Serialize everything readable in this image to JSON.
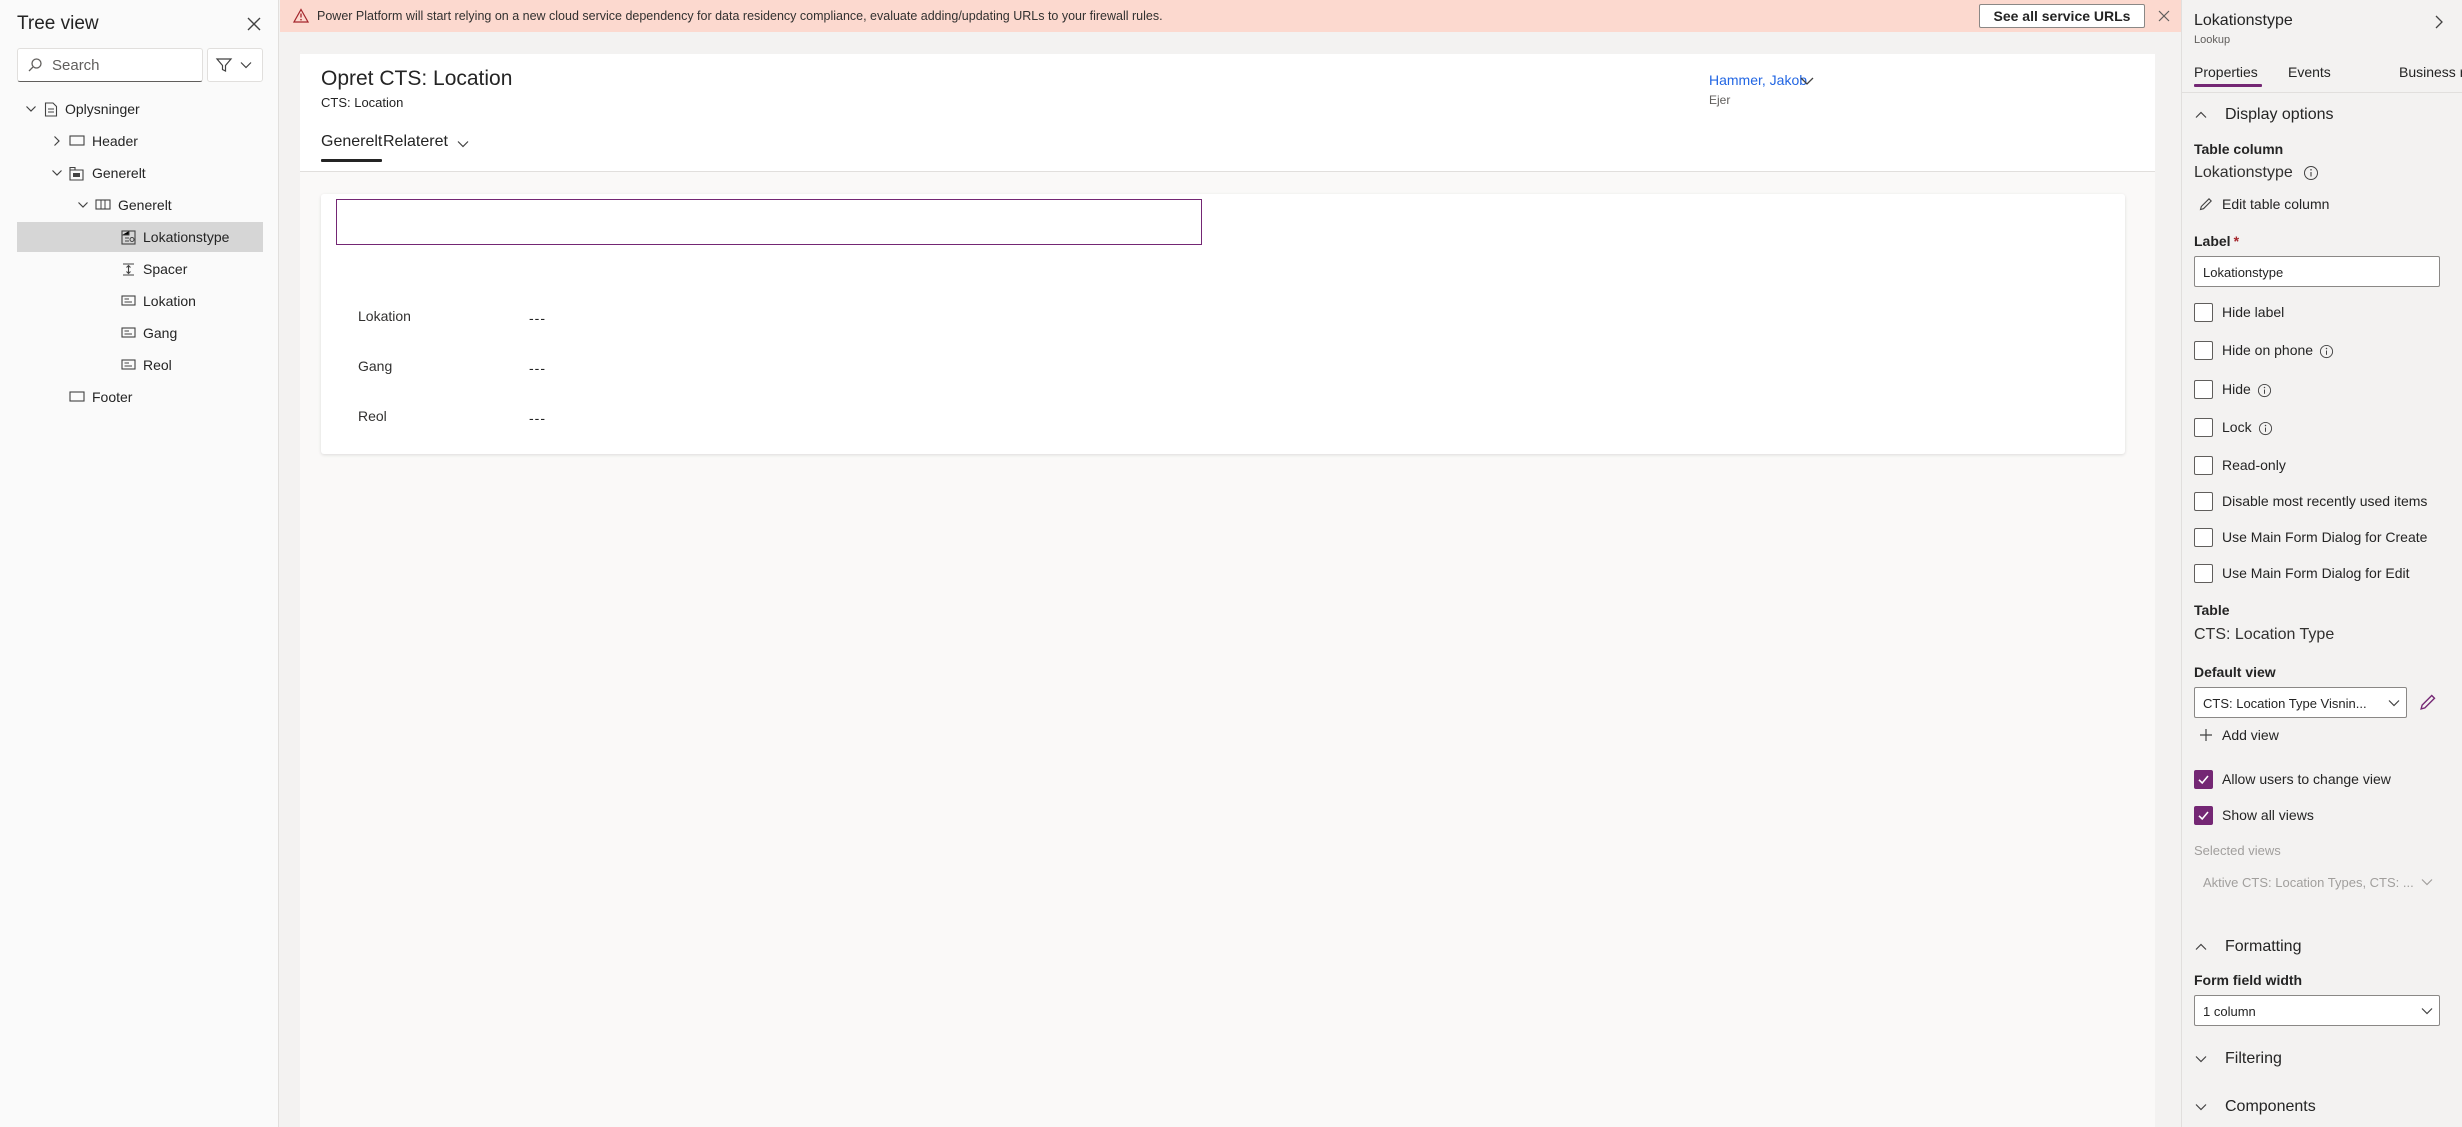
{
  "tree": {
    "title": "Tree view",
    "search_placeholder": "Search",
    "items": [
      {
        "label": "Oplysninger",
        "type": "form"
      },
      {
        "label": "Header",
        "type": "header"
      },
      {
        "label": "Generelt",
        "type": "tab"
      },
      {
        "label": "Generelt",
        "type": "section"
      },
      {
        "label": "Lokationstype",
        "type": "lookup-field",
        "selected": true
      },
      {
        "label": "Spacer",
        "type": "spacer"
      },
      {
        "label": "Lokation",
        "type": "field"
      },
      {
        "label": "Gang",
        "type": "field"
      },
      {
        "label": "Reol",
        "type": "field"
      },
      {
        "label": "Footer",
        "type": "footer"
      }
    ]
  },
  "banner": {
    "message": "Power Platform will start relying on a new cloud service dependency for data residency compliance, evaluate adding/updating URLs to your firewall rules.",
    "button_label": "See all service URLs"
  },
  "form": {
    "title": "Opret CTS: Location",
    "subtitle": "CTS: Location",
    "owner_name": "Hammer, Jakob",
    "owner_label": "Ejer",
    "tabs": [
      {
        "label": "Generelt",
        "active": true
      },
      {
        "label": "Relateret",
        "active": false
      }
    ],
    "fields": [
      {
        "label": "Lokation",
        "value": "---"
      },
      {
        "label": "Gang",
        "value": "---"
      },
      {
        "label": "Reol",
        "value": "---"
      }
    ]
  },
  "properties": {
    "title": "Lokationstype",
    "subtitle": "Lookup",
    "tabs": [
      "Properties",
      "Events",
      "Business rules"
    ],
    "display_options": {
      "heading": "Display options",
      "table_column_label": "Table column",
      "table_column_value": "Lokationstype",
      "edit_table_column": "Edit table column",
      "label_caption": "Label",
      "label_required": "*",
      "label_value": "Lokationstype",
      "checkboxes": [
        {
          "label": "Hide label",
          "checked": false
        },
        {
          "label": "Hide on phone",
          "checked": false
        },
        {
          "label": "Hide",
          "checked": false
        },
        {
          "label": "Lock",
          "checked": false
        },
        {
          "label": "Read-only",
          "checked": false
        },
        {
          "label": "Disable most recently used items",
          "checked": false
        },
        {
          "label": "Use Main Form Dialog for Create",
          "checked": false
        },
        {
          "label": "Use Main Form Dialog for Edit",
          "checked": false
        }
      ],
      "table_label": "Table",
      "table_value": "CTS: Location Type",
      "default_view_label": "Default view",
      "default_view_value": "CTS: Location Type Visnin...",
      "add_view": "Add view",
      "allow_change_view": {
        "label": "Allow users to change view",
        "checked": true
      },
      "show_all_views": {
        "label": "Show all views",
        "checked": true
      },
      "selected_views_label": "Selected views",
      "selected_views_value": "Aktive CTS: Location Types, CTS: ..."
    },
    "formatting": {
      "heading": "Formatting",
      "form_field_width_label": "Form field width",
      "form_field_width_value": "1 column"
    },
    "filtering": {
      "heading": "Filtering"
    },
    "components": {
      "heading": "Components"
    }
  },
  "colors": {
    "accent": "#742774",
    "link": "#2266e3",
    "banner_bg": "#fcd9cf",
    "warning": "#a4262c"
  }
}
